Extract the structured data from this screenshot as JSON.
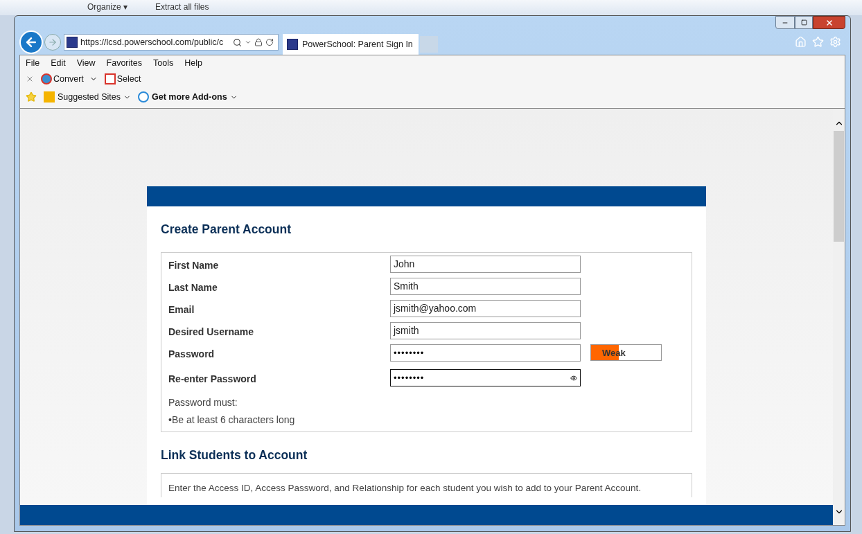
{
  "desktop": {
    "toolbar": [
      "Organize ▾",
      "Extract all files"
    ]
  },
  "browser": {
    "address": "https://lcsd.powerschool.com/public/c",
    "tabs": [
      {
        "label": "PowerSchool: Parent Sign In",
        "selected": true
      }
    ],
    "menu": [
      "File",
      "Edit",
      "View",
      "Favorites",
      "Tools",
      "Help"
    ],
    "command_bar": [
      {
        "label": "Convert",
        "kind": "convert"
      },
      {
        "label": "Select",
        "kind": "select"
      }
    ],
    "favorites_bar": [
      {
        "label": "Suggested Sites",
        "kind": "bing"
      },
      {
        "label": "Get more Add-ons",
        "kind": "addons"
      }
    ]
  },
  "page": {
    "title": "Create Parent Account",
    "fields": [
      {
        "label": "First Name",
        "value": "John",
        "kind": "text",
        "focused": false
      },
      {
        "label": "Last Name",
        "value": "Smith",
        "kind": "text",
        "focused": false
      },
      {
        "label": "Email",
        "value": "jsmith@yahoo.com",
        "kind": "text",
        "focused": false
      },
      {
        "label": "Desired Username",
        "value": "jsmith",
        "kind": "text",
        "focused": false
      },
      {
        "label": "Password",
        "value": "••••••••",
        "kind": "password",
        "focused": false,
        "strength": {
          "label": "Weak",
          "level": 0.4
        }
      },
      {
        "label": "Re-enter Password",
        "value": "••••••••",
        "kind": "password",
        "focused": true
      }
    ],
    "rules_title": "Password must:",
    "rules": [
      "•Be at least 6 characters long"
    ],
    "section2_title": "Link Students to Account",
    "section2_text": "Enter the Access ID, Access Password, and Relationship for each student you wish to add to your Parent Account."
  }
}
